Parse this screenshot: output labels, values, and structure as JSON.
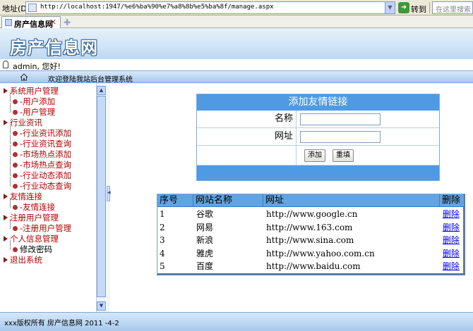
{
  "browser": {
    "address_label": "地址(D)",
    "url": "http://localhost:1947/%e6%ba%90%e7%a8%8b%e5%ba%8f/manage.aspx",
    "go_label": "转到",
    "search_placeholder": "在这里搜索（A）",
    "tab_title": "房产信息网"
  },
  "header": {
    "site_title": "房产信息网",
    "user_welcome": "admin, 您好!",
    "nav_welcome": "欢迎登陆我站后台管理系统"
  },
  "sidebar": {
    "items": [
      {
        "label": "系统用户管理",
        "level": 0
      },
      {
        "label": "-用户添加",
        "level": 1
      },
      {
        "label": "-用户管理",
        "level": 1
      },
      {
        "label": "行业资讯",
        "level": 0
      },
      {
        "label": "-行业资讯添加",
        "level": 1
      },
      {
        "label": "-行业资讯查询",
        "level": 1
      },
      {
        "label": "-市场热点添加",
        "level": 1
      },
      {
        "label": "-市场热点查询",
        "level": 1
      },
      {
        "label": "-行业动态添加",
        "level": 1
      },
      {
        "label": "-行业动态查询",
        "level": 1
      },
      {
        "label": "友情连接",
        "level": 0
      },
      {
        "label": "-友情连接",
        "level": 1
      },
      {
        "label": "注册用户管理",
        "level": 0
      },
      {
        "label": "-注册用户管理",
        "level": 1
      },
      {
        "label": "个人信息管理",
        "level": 0
      },
      {
        "label": "修改密码",
        "level": 1
      },
      {
        "label": "退出系统",
        "level": 0
      }
    ]
  },
  "form": {
    "title": "添加友情链接",
    "name_label": "名称",
    "url_label": "网址",
    "name_value": "",
    "url_value": "",
    "add_button": "添加",
    "reset_button": "重填"
  },
  "table": {
    "headers": [
      "序号",
      "网站名称",
      "网址",
      "删除"
    ],
    "rows": [
      {
        "id": "1",
        "name": "谷歌",
        "url": "http://www.google.cn",
        "action": "删除"
      },
      {
        "id": "2",
        "name": "网易",
        "url": "http://www.163.com",
        "action": "删除"
      },
      {
        "id": "3",
        "name": "新浪",
        "url": "http://www.sina.com",
        "action": "删除"
      },
      {
        "id": "4",
        "name": "雅虎",
        "url": "http://www.yahoo.com.cn",
        "action": "删除"
      },
      {
        "id": "5",
        "name": "百度",
        "url": "http://www.baidu.com",
        "action": "删除"
      }
    ]
  },
  "footer": {
    "text": "xxx版权所有  房产信息网  2011 -4-2"
  },
  "colors": {
    "accent": "#4f9ae3",
    "menu_text": "#b00000",
    "link": "#0000ee"
  }
}
